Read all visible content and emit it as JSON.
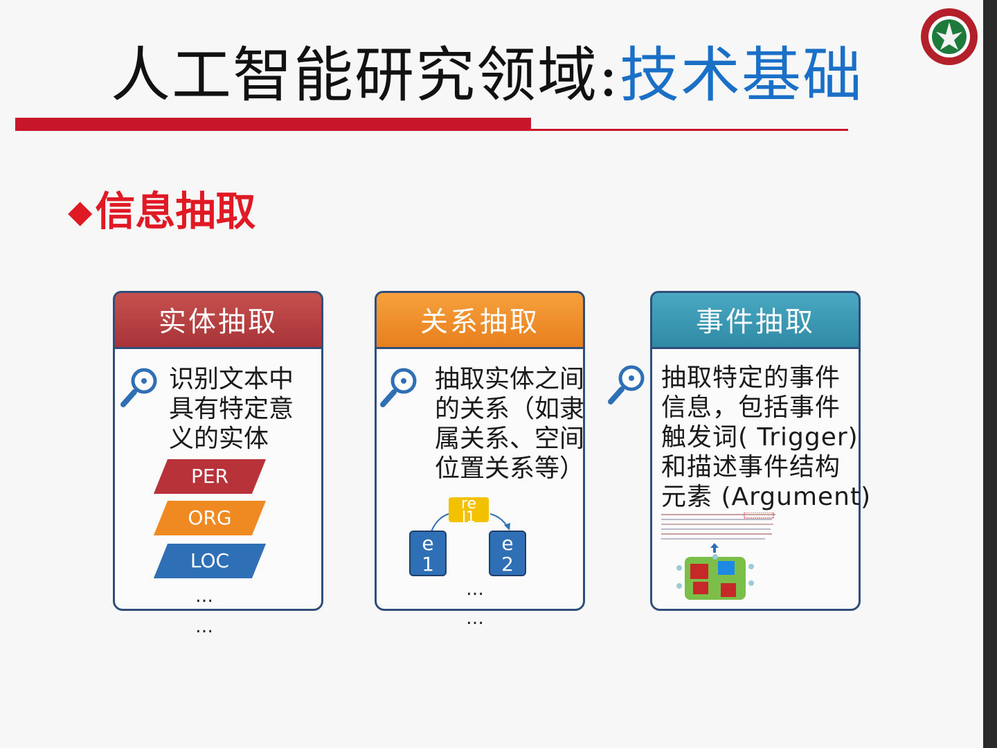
{
  "header": {
    "title_black": "人工智能研究领域:",
    "title_blue": "技术基础"
  },
  "section": {
    "bullet": "◆",
    "heading": "信息抽取"
  },
  "cards": [
    {
      "title": "实体抽取",
      "text": "识别文本中\n具有特定意\n义的实体",
      "tags": [
        "PER",
        "ORG",
        "LOC"
      ],
      "dots": [
        "…",
        "…"
      ]
    },
    {
      "title": "关系抽取",
      "text": "抽取实体之间\n的关系（如隶\n属关系、空间\n位置关系等）",
      "relation_label": "re\nl1",
      "entity_1": "e\n1",
      "entity_2": "e\n2",
      "dots": [
        "…",
        "…"
      ]
    },
    {
      "title": "事件抽取",
      "text": "抽取特定的事件\n信息，包括事件\n触发词( Trigger)\n和描述事件结构\n元素 (Argument)"
    }
  ],
  "colors": {
    "accent_red": "#c8162b",
    "title_blue": "#1a6fc7",
    "tag_per": "#b8323a",
    "tag_org": "#ef8a22",
    "tag_loc": "#2f6fb5"
  }
}
